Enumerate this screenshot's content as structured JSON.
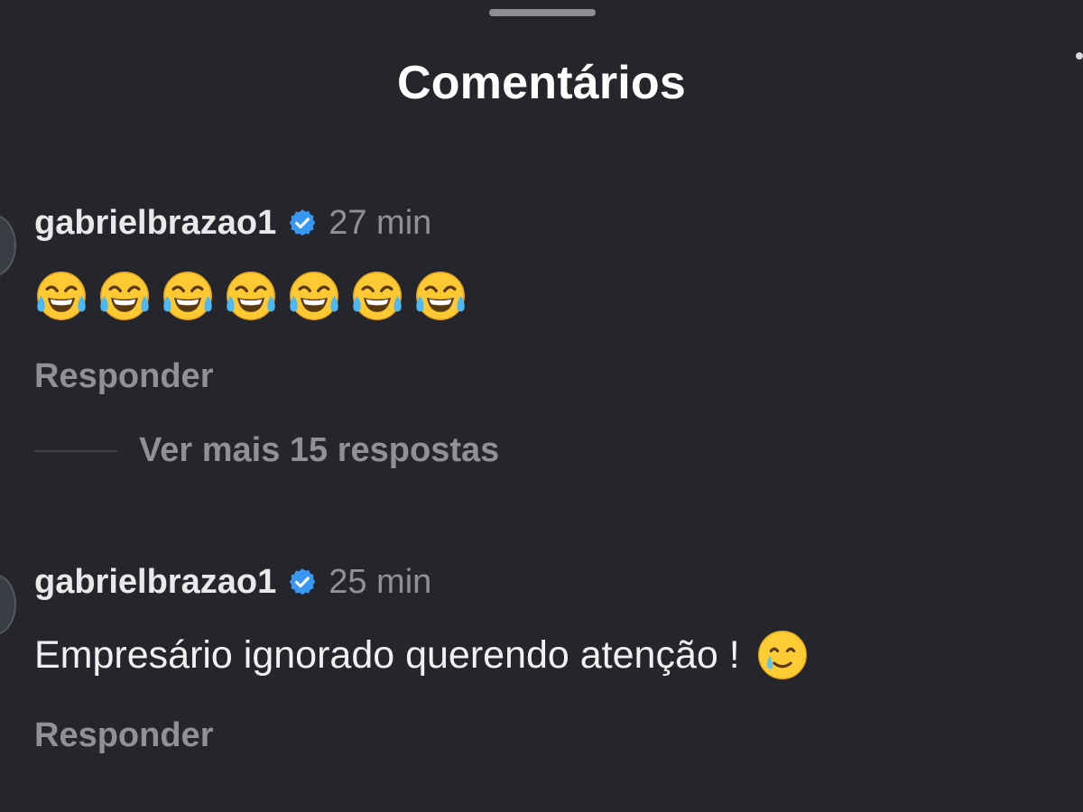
{
  "sheet": {
    "title": "Comentários"
  },
  "comments": [
    {
      "username": "gabrielbrazao1",
      "time": "27 min",
      "body_emojis": [
        "laugh-cry-emoji",
        "laugh-cry-emoji",
        "laugh-cry-emoji",
        "laugh-cry-emoji",
        "laugh-cry-emoji",
        "laugh-cry-emoji",
        "laugh-cry-emoji"
      ],
      "reply_label": "Responder"
    },
    {
      "username": "gabrielbrazao1",
      "time": "25 min",
      "body_text": "Empresário ignorado querendo atenção !",
      "body_emoji": "smiling-tear-emoji",
      "reply_label": "Responder"
    }
  ],
  "more_replies": {
    "label": "Ver mais 15 respostas"
  },
  "colors": {
    "background": "#24262b",
    "verified": "#3897f0",
    "muted_text": "#8f9197"
  }
}
